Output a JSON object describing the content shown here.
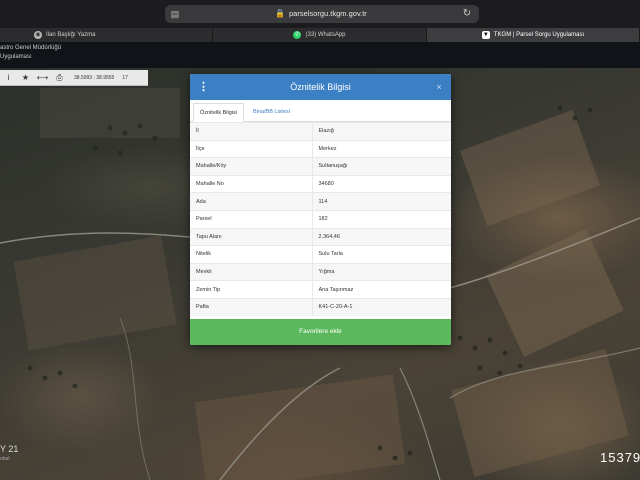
{
  "browser": {
    "url": "parselsorgu.tkgm.gov.tr",
    "reader_icon": "reader-icon",
    "lock_icon": "lock-icon",
    "reload_icon": "reload-icon",
    "tabs": [
      {
        "label": "İlan Başlığı Yazma",
        "icon": "globe-icon"
      },
      {
        "label": "(33) WhatsApp",
        "icon": "whatsapp-icon"
      },
      {
        "label": "TKGM | Parsel Sorgu Uygulaması",
        "icon": "tkgm-icon"
      }
    ]
  },
  "site_header": {
    "line1": "astro Genel Müdürlüğü",
    "line2": "Uygulaması"
  },
  "map_toolbar": {
    "info": "i",
    "star": "★",
    "measure": "⟷",
    "print": "⎙",
    "coords": "38.5993 : 38.9555",
    "zoom": "17"
  },
  "map": {
    "date": "Y 21",
    "date_sub": "obal",
    "number": "15379"
  },
  "modal": {
    "title": "Öznitelik Bilgisi",
    "close": "×",
    "tabs": [
      "Öznitelik Bilgisi",
      "Bina/BB Listesi"
    ],
    "rows": [
      {
        "key": "İl",
        "value": "Elazığ"
      },
      {
        "key": "İlçe",
        "value": "Merkez"
      },
      {
        "key": "Mahalle/Köy",
        "value": "Sultanuşağı"
      },
      {
        "key": "Mahalle No",
        "value": "34680"
      },
      {
        "key": "Ada",
        "value": "114"
      },
      {
        "key": "Parsel",
        "value": "182"
      },
      {
        "key": "Tapu Alanı",
        "value": "2.364,46"
      },
      {
        "key": "Nitelik",
        "value": "Sulu Tarla"
      },
      {
        "key": "Mevkii",
        "value": "Yığma"
      },
      {
        "key": "Zemin Tip",
        "value": "Ana Taşınmaz"
      },
      {
        "key": "Pafta",
        "value": "K41-C-20-A-1"
      }
    ],
    "button": "Favorilere ekle"
  },
  "colors": {
    "header_blue": "#3b7fc4",
    "button_green": "#5cb85c"
  }
}
